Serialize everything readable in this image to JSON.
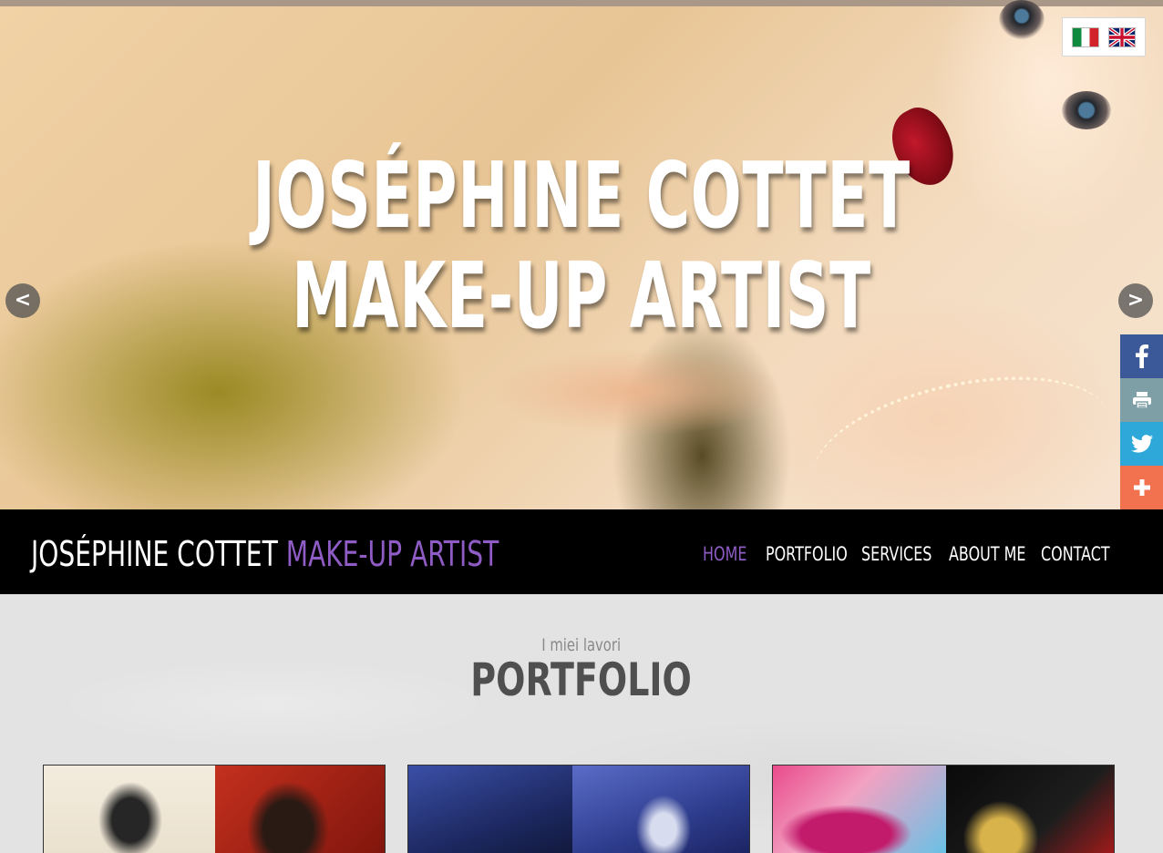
{
  "hero": {
    "title_line1": "JOSÉPHINE COTTET",
    "title_line2": "MAKE-UP ARTIST",
    "prev_label": "<",
    "next_label": ">"
  },
  "languages": [
    {
      "code": "it",
      "icon": "italy-flag-icon"
    },
    {
      "code": "en",
      "icon": "uk-flag-icon"
    }
  ],
  "share": [
    {
      "name": "facebook",
      "icon": "facebook-icon",
      "color": "#3b5998"
    },
    {
      "name": "print",
      "icon": "print-icon",
      "color": "#7e9fa5"
    },
    {
      "name": "twitter",
      "icon": "twitter-icon",
      "color": "#2ea8d9"
    },
    {
      "name": "more",
      "icon": "plus-icon",
      "color": "#f2714e"
    }
  ],
  "navbar": {
    "brand_main": "JOSÉPHINE COTTET",
    "brand_accent": "MAKE-UP ARTIST",
    "accent_color": "#8e5cc4",
    "items": [
      {
        "label": "HOME",
        "active": true
      },
      {
        "label": "PORTFOLIO",
        "active": false
      },
      {
        "label": "SERVICES",
        "active": false
      },
      {
        "label": "ABOUT ME",
        "active": false
      },
      {
        "label": "CONTACT",
        "active": false
      }
    ]
  },
  "portfolio": {
    "subtitle": "I miei lavori",
    "title": "PORTFOLIO"
  }
}
